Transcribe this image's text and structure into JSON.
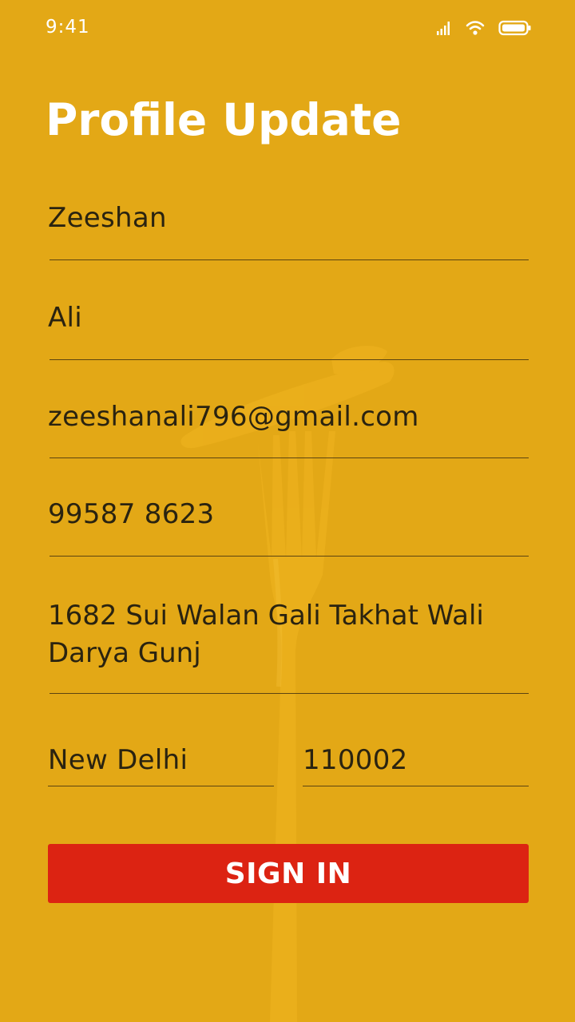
{
  "status_bar": {
    "time": "9:41",
    "icons": [
      "signal-icon",
      "wifi-icon",
      "battery-icon"
    ]
  },
  "page": {
    "title": "Profile Update"
  },
  "form": {
    "first_name": "Zeeshan",
    "last_name": "Ali",
    "email": "zeeshanali796@gmail.com",
    "phone": "99587 8623",
    "address": "1682 Sui Walan Gali Takhat Wali\nDarya Gunj",
    "city": "New Delhi",
    "pincode": "110002"
  },
  "actions": {
    "submit_label": "SIGN IN"
  },
  "colors": {
    "background": "#e3a816",
    "button": "#dc2312",
    "text": "#2a2310",
    "title": "#ffffff"
  }
}
